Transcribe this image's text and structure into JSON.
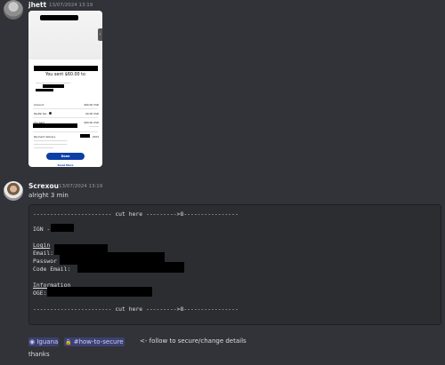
{
  "messages": [
    {
      "author": "jhett",
      "timestamp": "13/07/2024 13:19",
      "attachment": {
        "sent_title": "You sent $60.00 to",
        "rows": [
          {
            "label": "Amount",
            "value": "$60.00 USD"
          },
          {
            "label": "PayPal fee",
            "value": "$0.00 USD"
          },
          {
            "label": "You paid",
            "value": "$60.00 USD"
          }
        ],
        "payment_delivery_label": "Payment delivery",
        "payment_delivery_value": "2024",
        "done_label": "Done",
        "send_more_label": "Send More"
      }
    },
    {
      "author": "Screxou",
      "timestamp": "13/07/2024 13:19",
      "text": "alright 3 min",
      "code_block": {
        "cut_top": "----------------------- cut here --------->8----------------",
        "ign": "IGN -",
        "login_header": "Login",
        "email": "Email:",
        "password": "Passwor",
        "code_email": "Code Email:",
        "info_header": "Information",
        "oge": "OGE:",
        "cut_bottom": "----------------------- cut here --------->8----------------"
      },
      "mention_user": "Iguana",
      "mention_channel": "#how-to-secure",
      "follow_text": "<- follow to secure/change details",
      "closing": "thanks"
    }
  ],
  "colors": {
    "background": "#323339",
    "code_background": "#2b2d31",
    "mention_background": "#4b4f8a",
    "paypal_blue": "#0c3fa6"
  }
}
